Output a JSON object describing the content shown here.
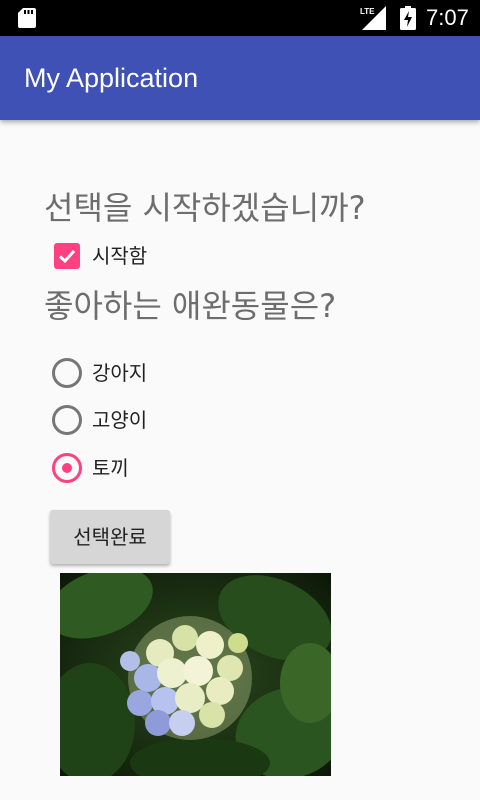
{
  "status_bar": {
    "time": "7:07",
    "network": "LTE",
    "icons": [
      "sd-card-icon",
      "lte-signal-icon",
      "battery-charging-icon"
    ]
  },
  "app_bar": {
    "title": "My Application",
    "color": "#3f51b5"
  },
  "main": {
    "question_start": "선택을 시작하겠습니까?",
    "start_checkbox": {
      "label": "시작함",
      "checked": true
    },
    "question_pet": "좋아하는 애완동물은?",
    "pet_options": [
      {
        "label": "강아지",
        "selected": false
      },
      {
        "label": "고양이",
        "selected": false
      },
      {
        "label": "토끼",
        "selected": true
      }
    ],
    "done_button": "선택완료",
    "image_icon": "hydrangea-flower-photo"
  },
  "colors": {
    "accent": "#ff4081",
    "primary": "#3f51b5",
    "background": "#fafafa"
  }
}
